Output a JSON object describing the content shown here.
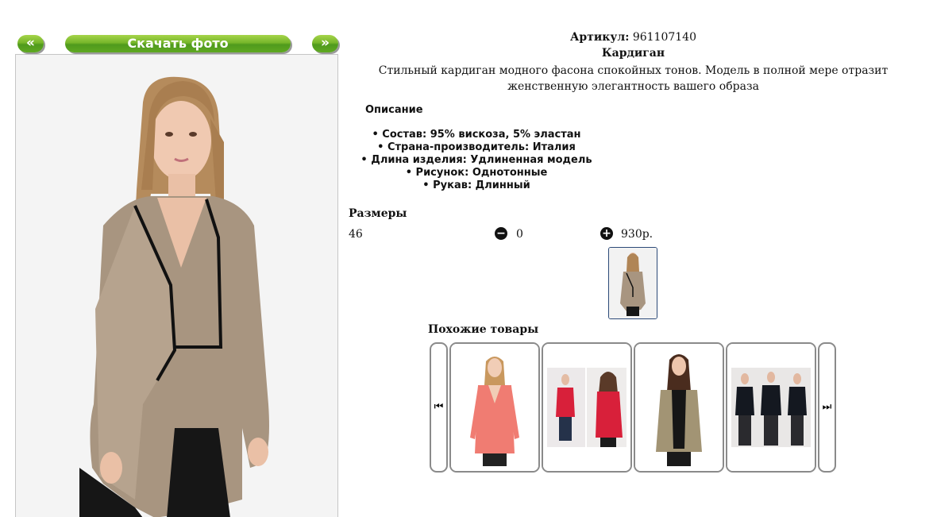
{
  "toolbar": {
    "prev_label": "«",
    "download_label": "Скачать фото",
    "next_label": "»"
  },
  "product": {
    "article_label": "Артикул:",
    "article_value": "961107140",
    "name": "Кардиган",
    "description": "Стильный кардиган модного фасона спокойных тонов. Модель в полной мере отразит женственную элегантность вашего образа"
  },
  "specs": {
    "heading": "Описание",
    "items": [
      "Состав: 95% вискоза, 5% эластан",
      "Страна-производитель: Италия",
      "Длина изделия: Удлиненная модель",
      "Рисунок: Однотонные",
      "Рукав: Длинный"
    ]
  },
  "sizes": {
    "heading": "Размеры",
    "rows": [
      {
        "size": "46",
        "quantity": "0",
        "price": "930р."
      }
    ]
  },
  "similar": {
    "heading": "Похожие товары",
    "prev_icon": "skip-previous-icon",
    "next_icon": "skip-next-icon",
    "items": [
      {
        "image": "pink-cardigan-photo"
      },
      {
        "image": "red-sweater-photo"
      },
      {
        "image": "khaki-cardigan-photo"
      },
      {
        "image": "black-sweater-photo"
      }
    ]
  },
  "colors": {
    "button_green": "#6fb227",
    "cardigan_taupe": "#a89580",
    "thumb_border": "#2c4a78"
  }
}
